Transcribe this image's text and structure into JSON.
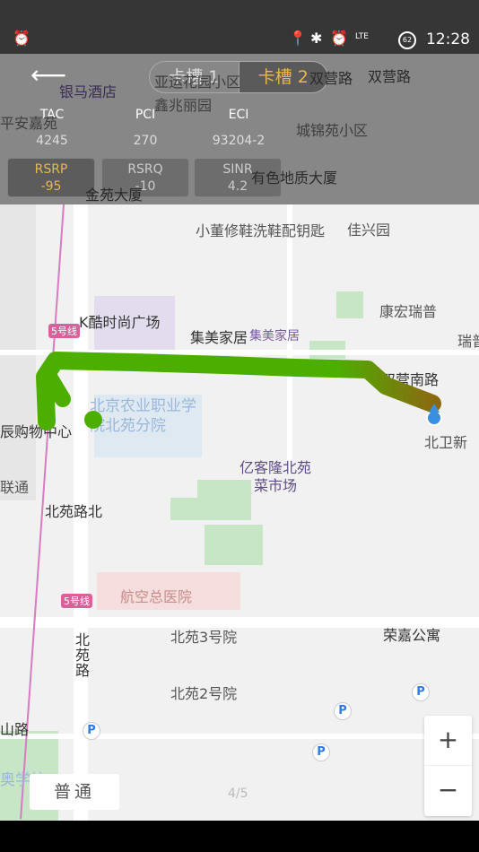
{
  "status_bar": {
    "time": "12:28",
    "battery": "62",
    "network": "LTE",
    "icons": [
      "alarm-icon",
      "location-icon",
      "bluetooth-icon",
      "alarm-icon",
      "signal-icon",
      "battery-icon"
    ]
  },
  "header": {
    "back_icon": "arrow-left-icon",
    "tabs": [
      {
        "label": "卡槽 1",
        "active": false
      },
      {
        "label": "卡槽 2",
        "active": true
      }
    ],
    "accent": "#e8b84a"
  },
  "cell_info": {
    "tac": {
      "label": "TAC",
      "value": "4245"
    },
    "pci": {
      "label": "PCI",
      "value": "270"
    },
    "eci": {
      "label": "ECI",
      "value": "93204-2"
    }
  },
  "metrics": [
    {
      "label": "RSRP",
      "value": "-95",
      "active": true
    },
    {
      "label": "RSRQ",
      "value": "-10",
      "active": false
    },
    {
      "label": "SINR",
      "value": "4.2",
      "active": false
    }
  ],
  "map": {
    "labels": [
      "银马酒店",
      "亚运花园小区",
      "鑫兆丽园",
      "双营路",
      "双营路",
      "平安嘉苑",
      "城锦苑小区",
      "金苑大厦",
      "有色地质大厦",
      "小董修鞋洗鞋配钥匙",
      "佳兴园",
      "康宏瑞普",
      "瑞普",
      "K酷时尚广场",
      "集美家居",
      "集美家居",
      "5号线",
      "北京农业职业学院北苑分院",
      "辰购物中心",
      "双营南路",
      "北卫新",
      "亿客隆北苑菜市场",
      "北苑路北",
      "联通",
      "航空总医院",
      "5号线",
      "北苑路",
      "北苑3号院",
      "荣嘉公寓",
      "北苑2号院",
      "山路",
      "奥学校"
    ],
    "parking_label": "P",
    "track_colors": [
      "#4caf00",
      "#8a6a10"
    ]
  },
  "controls": {
    "zoom_in": "+",
    "zoom_out": "−",
    "map_mode": "普通",
    "page_indicator": "4/5"
  }
}
